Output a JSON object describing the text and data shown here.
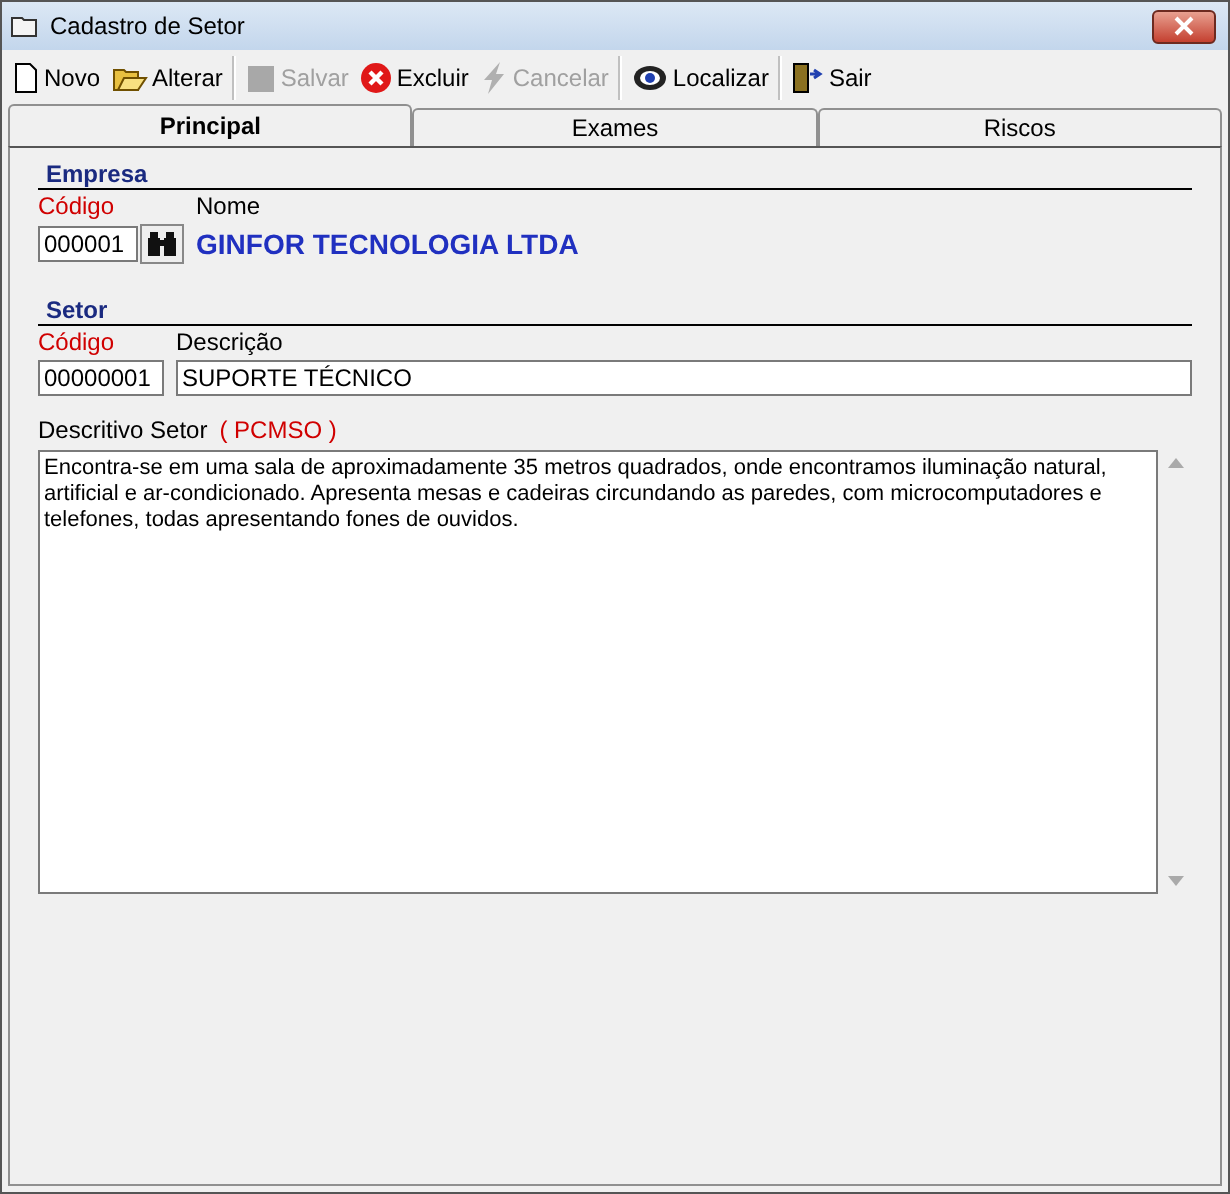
{
  "window": {
    "title": "Cadastro de Setor"
  },
  "toolbar": [
    {
      "label": "Novo",
      "kind": "new",
      "disabled": false
    },
    {
      "label": "Alterar",
      "kind": "edit",
      "disabled": false
    },
    {
      "label": "Salvar",
      "kind": "save",
      "disabled": true
    },
    {
      "label": "Excluir",
      "kind": "delete",
      "disabled": false
    },
    {
      "label": "Cancelar",
      "kind": "cancel",
      "disabled": true
    },
    {
      "label": "Localizar",
      "kind": "find",
      "disabled": false
    },
    {
      "label": "Sair",
      "kind": "exit",
      "disabled": false
    }
  ],
  "tabs": [
    {
      "label": "Principal",
      "selected": true
    },
    {
      "label": "Exames",
      "selected": false
    },
    {
      "label": "Riscos",
      "selected": false
    }
  ],
  "empresa": {
    "heading": "Empresa",
    "code_label": "Código",
    "code": "000001",
    "name_label": "Nome",
    "name": "GINFOR TECNOLOGIA LTDA"
  },
  "setor": {
    "heading": "Setor",
    "code_label": "Código",
    "code": "00000001",
    "desc_label": "Descrição",
    "desc": "SUPORTE TÉCNICO"
  },
  "descritivo": {
    "label": "Descritivo Setor",
    "tag": "( PCMSO )",
    "text": "Encontra-se em uma sala de aproximadamente 35 metros quadrados, onde encontramos iluminação natural, artificial e ar-condicionado. Apresenta mesas e cadeiras circundando as paredes, com microcomputadores e telefones, todas apresentando fones de ouvidos."
  }
}
